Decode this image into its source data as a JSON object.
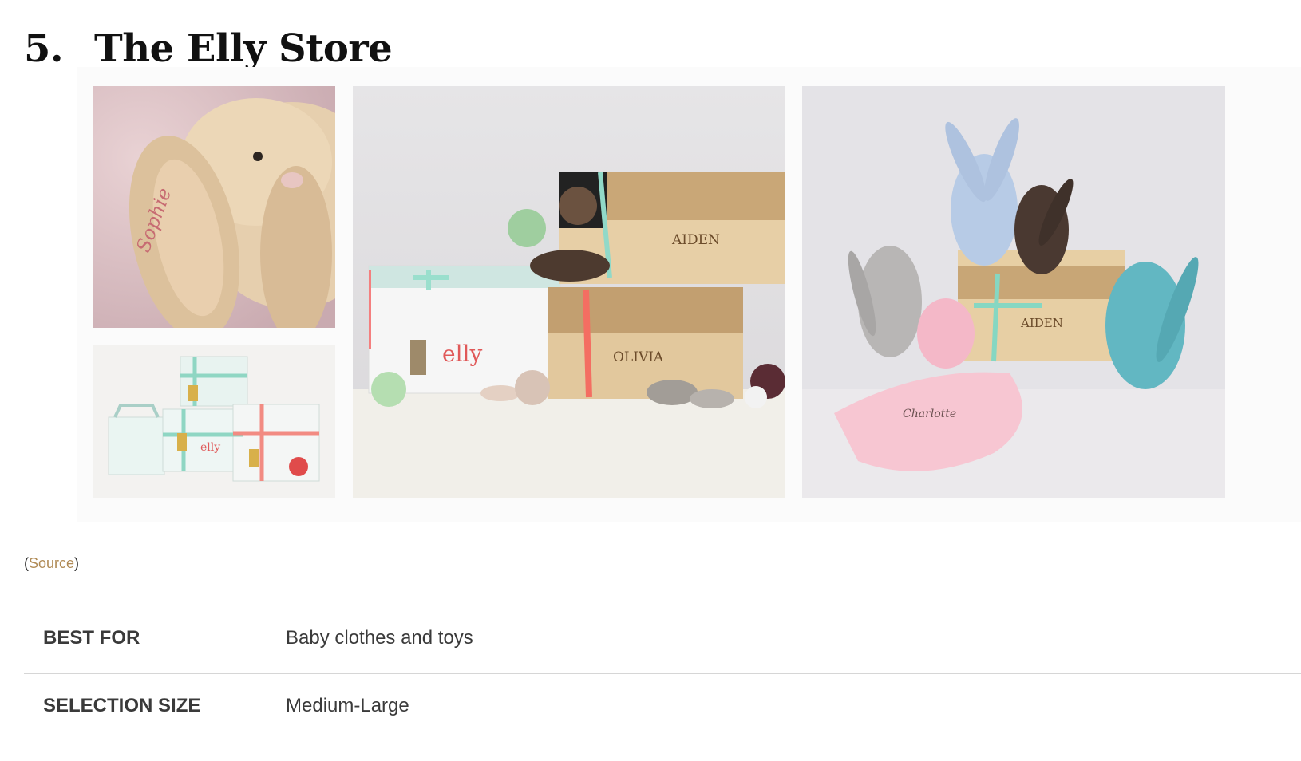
{
  "section": {
    "number": "5.",
    "title": "The Elly Store"
  },
  "images": {
    "top_left": {
      "alt": "Plush bunny with embroidered name"
    },
    "bottom_left": {
      "alt": "Elly gift boxes"
    },
    "center": {
      "alt": "Wooden gift crates with shoes and plush toys",
      "logo_text": "elly",
      "crate_top": "AIDEN",
      "crate_bottom": "OLIVIA"
    },
    "right": {
      "alt": "Plush bunnies on a wooden crate with pink blanket",
      "crate": "AIDEN"
    }
  },
  "source": {
    "open": "(",
    "link_label": "Source",
    "close": ")"
  },
  "specs": [
    {
      "label": "BEST FOR",
      "value": "Baby clothes and toys"
    },
    {
      "label": "SELECTION SIZE",
      "value": "Medium-Large"
    }
  ]
}
